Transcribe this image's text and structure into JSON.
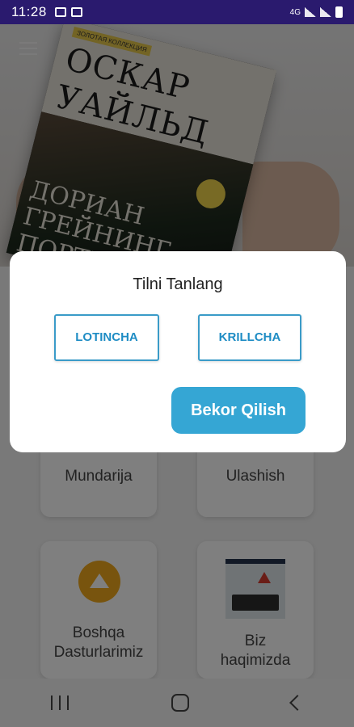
{
  "status_bar": {
    "time": "11:28",
    "network": "4G"
  },
  "hero": {
    "book_series": "ЗОЛОТАЯ КОЛЛЕКЦИЯ",
    "book_author_line1": "ОСКАР",
    "book_author_line2": "УАЙЛЬД",
    "book_subtitle_line1": "ДОРИАН",
    "book_subtitle_line2": "ГРЕЙНИНГ",
    "book_subtitle_line3": "ПОРТРЕТИ"
  },
  "tiles": {
    "contents_label": "Mundarija",
    "share_label": "Ulashish",
    "other_apps_label_line1": "Boshqa",
    "other_apps_label_line2": "Dasturlarimiz",
    "about_label_line1": "Biz",
    "about_label_line2": "haqimizda"
  },
  "dialog": {
    "title": "Tilni Tanlang",
    "latin_label": "LOTINCHA",
    "cyrillic_label": "KRILLCHA",
    "cancel_label": "Bekor Qilish"
  },
  "colors": {
    "status_bar_bg": "#2a1a6e",
    "accent": "#35a6d4",
    "lang_button_text": "#1e8cc4"
  }
}
